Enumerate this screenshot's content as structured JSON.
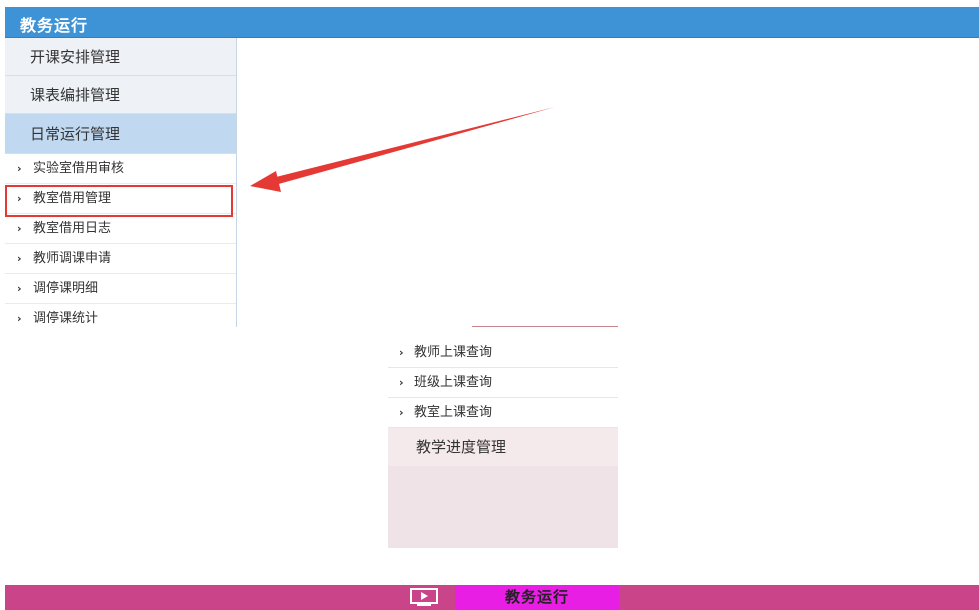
{
  "header": {
    "title": "教务运行"
  },
  "left_menu": {
    "categories": [
      {
        "label": "开课安排管理"
      },
      {
        "label": "课表编排管理"
      },
      {
        "label": "日常运行管理"
      }
    ],
    "items": [
      {
        "label": "实验室借用审核"
      },
      {
        "label": "教室借用管理"
      },
      {
        "label": "教室借用日志"
      },
      {
        "label": "教师调课申请"
      },
      {
        "label": "调停课明细"
      },
      {
        "label": "调停课统计"
      }
    ],
    "chevron": "›"
  },
  "middle_menu": {
    "items": [
      {
        "label": "教师上课查询"
      },
      {
        "label": "班级上课查询"
      },
      {
        "label": "教室上课查询"
      }
    ],
    "category": {
      "label": "教学进度管理"
    },
    "chevron": "›"
  },
  "bottom_bar": {
    "tab_label": "教务运行",
    "icon": "play-screen-icon"
  },
  "annotations": {
    "highlight_color": "#e53935",
    "arrow_color": "#e53935"
  }
}
